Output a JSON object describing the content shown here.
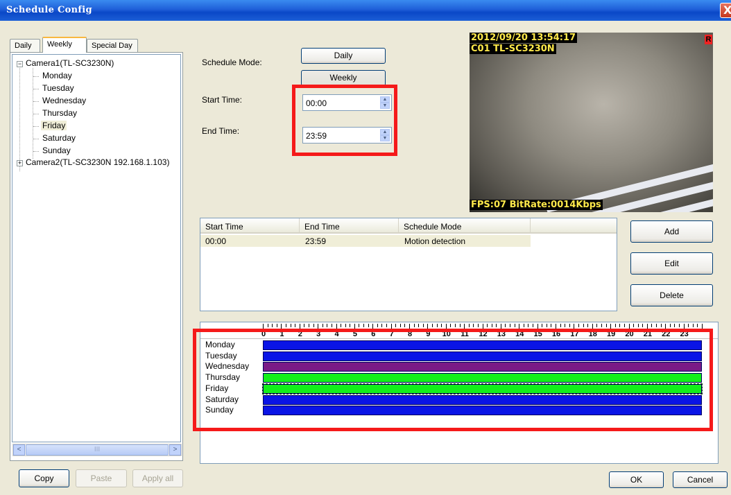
{
  "window": {
    "title": "Schedule Config",
    "close_glyph": "X"
  },
  "left_tabs": [
    "Daily",
    "Weekly",
    "Special Day"
  ],
  "tree": {
    "camera1": {
      "label": "Camera1(TL-SC3230N)",
      "expand_glyph": "−"
    },
    "days": [
      "Monday",
      "Tuesday",
      "Wednesday",
      "Thursday",
      "Friday",
      "Saturday",
      "Sunday"
    ],
    "selected_day": "Friday",
    "camera2": {
      "label": "Camera2(TL-SC3230N 192.168.1.103)",
      "expand_glyph": "+"
    }
  },
  "scroll": {
    "left": "<",
    "right": ">",
    "grip": "III"
  },
  "left_buttons": {
    "copy": "Copy",
    "paste": "Paste",
    "apply_all": "Apply all"
  },
  "form": {
    "schedule_mode_label": "Schedule Mode:",
    "mode_daily": "Daily",
    "mode_weekly": "Weekly",
    "start_label": "Start Time:",
    "start_value": "00:00",
    "end_label": "End Time:",
    "end_value": "23:59",
    "spin_up": "▲",
    "spin_down": "▼"
  },
  "video": {
    "timestamp": "2012/09/20 13:54:17",
    "camera": "C01 TL-SC3230N",
    "rec": "R",
    "stats": "FPS:07 BitRate:0014Kbps"
  },
  "schedule_list": {
    "columns": [
      "Start Time",
      "End Time",
      "Schedule Mode"
    ],
    "rows": [
      {
        "start": "00:00",
        "end": "23:59",
        "mode": "Motion detection"
      }
    ]
  },
  "action_buttons": {
    "add": "Add",
    "edit": "Edit",
    "delete": "Delete"
  },
  "timeline": {
    "hours": [
      "0",
      "1",
      "2",
      "3",
      "4",
      "5",
      "6",
      "7",
      "8",
      "9",
      "10",
      "11",
      "12",
      "13",
      "14",
      "15",
      "16",
      "17",
      "18",
      "19",
      "20",
      "21",
      "22",
      "23"
    ],
    "days": [
      {
        "name": "Monday",
        "color": "#0a14e6"
      },
      {
        "name": "Tuesday",
        "color": "#0a14e6"
      },
      {
        "name": "Wednesday",
        "color": "#7a1a86"
      },
      {
        "name": "Thursday",
        "color": "#13f01a"
      },
      {
        "name": "Friday",
        "color": "#13f01a",
        "selected": true
      },
      {
        "name": "Saturday",
        "color": "#0a14e6"
      },
      {
        "name": "Sunday",
        "color": "#0a14e6"
      }
    ]
  },
  "dialog_buttons": {
    "ok": "OK",
    "cancel": "Cancel"
  },
  "colors": {
    "highlight": "#f51a1a",
    "osd_text": "#ffe94a",
    "title_bar": "#0a47c7"
  }
}
